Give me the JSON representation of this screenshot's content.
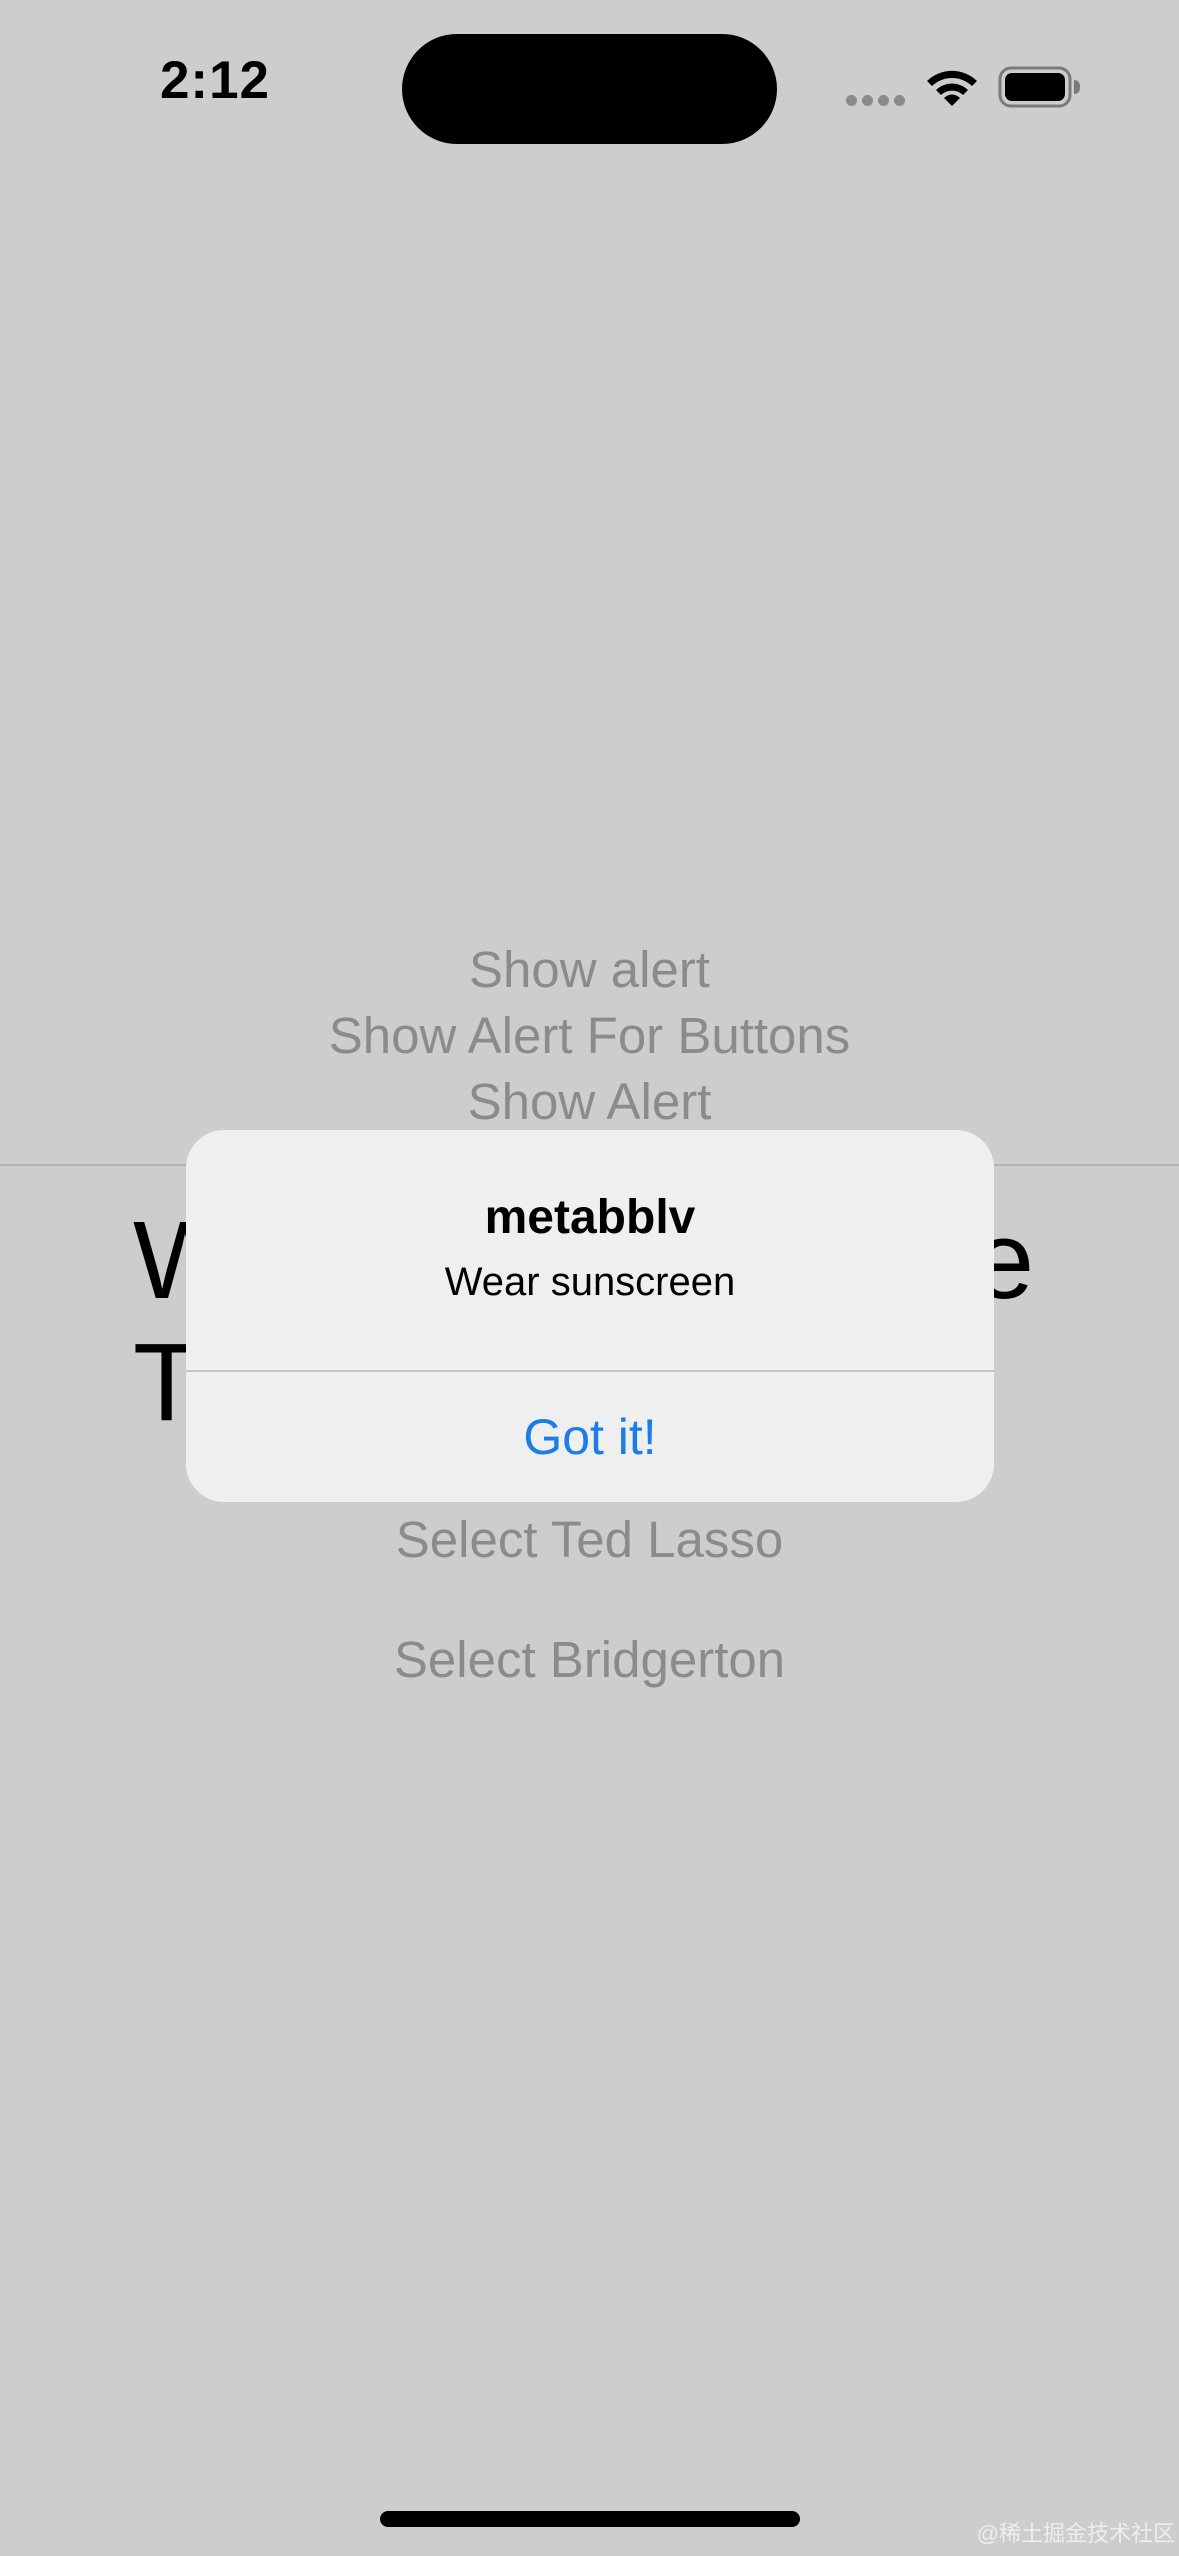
{
  "status_bar": {
    "time": "2:12",
    "icons": [
      "signal-dots-icon",
      "wifi-icon",
      "battery-icon"
    ]
  },
  "background": {
    "links": [
      "Show alert",
      "Show Alert For Buttons",
      "Show Alert",
      "Select Ted Lasso",
      "Select Bridgerton"
    ],
    "heading_fragments": [
      "W",
      "e",
      "T"
    ]
  },
  "alert": {
    "title": "metabblv",
    "message": "Wear sunscreen",
    "button": "Got it!"
  },
  "watermark": "@稀土掘金技术社区",
  "colors": {
    "background": "#cdcdcd",
    "alert_background": "#efefef",
    "accent": "#1a7ee6",
    "muted_text": "#8b8b8b"
  }
}
